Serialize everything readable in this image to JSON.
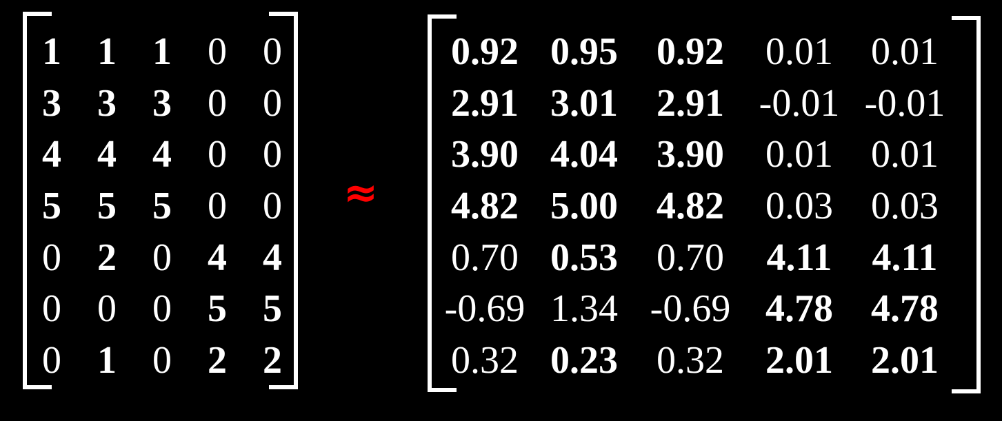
{
  "approx_symbol": "≈",
  "approx_color": "#ff0000",
  "matrix_a": {
    "rows": [
      [
        {
          "v": "1",
          "bold": true
        },
        {
          "v": "1",
          "bold": true
        },
        {
          "v": "1",
          "bold": true
        },
        {
          "v": "0",
          "bold": false
        },
        {
          "v": "0",
          "bold": false
        }
      ],
      [
        {
          "v": "3",
          "bold": true
        },
        {
          "v": "3",
          "bold": true
        },
        {
          "v": "3",
          "bold": true
        },
        {
          "v": "0",
          "bold": false
        },
        {
          "v": "0",
          "bold": false
        }
      ],
      [
        {
          "v": "4",
          "bold": true
        },
        {
          "v": "4",
          "bold": true
        },
        {
          "v": "4",
          "bold": true
        },
        {
          "v": "0",
          "bold": false
        },
        {
          "v": "0",
          "bold": false
        }
      ],
      [
        {
          "v": "5",
          "bold": true
        },
        {
          "v": "5",
          "bold": true
        },
        {
          "v": "5",
          "bold": true
        },
        {
          "v": "0",
          "bold": false
        },
        {
          "v": "0",
          "bold": false
        }
      ],
      [
        {
          "v": "0",
          "bold": false
        },
        {
          "v": "2",
          "bold": true
        },
        {
          "v": "0",
          "bold": false
        },
        {
          "v": "4",
          "bold": true
        },
        {
          "v": "4",
          "bold": true
        }
      ],
      [
        {
          "v": "0",
          "bold": false
        },
        {
          "v": "0",
          "bold": false
        },
        {
          "v": "0",
          "bold": false
        },
        {
          "v": "5",
          "bold": true
        },
        {
          "v": "5",
          "bold": true
        }
      ],
      [
        {
          "v": "0",
          "bold": false
        },
        {
          "v": "1",
          "bold": true
        },
        {
          "v": "0",
          "bold": false
        },
        {
          "v": "2",
          "bold": true
        },
        {
          "v": "2",
          "bold": true
        }
      ]
    ]
  },
  "matrix_b": {
    "rows": [
      [
        {
          "v": "0.92",
          "bold": true
        },
        {
          "v": "0.95",
          "bold": true
        },
        {
          "v": "0.92",
          "bold": true
        },
        {
          "v": "0.01",
          "bold": false
        },
        {
          "v": "0.01",
          "bold": false
        }
      ],
      [
        {
          "v": "2.91",
          "bold": true
        },
        {
          "v": "3.01",
          "bold": true
        },
        {
          "v": "2.91",
          "bold": true
        },
        {
          "v": "-0.01",
          "bold": false
        },
        {
          "v": "-0.01",
          "bold": false
        }
      ],
      [
        {
          "v": "3.90",
          "bold": true
        },
        {
          "v": "4.04",
          "bold": true
        },
        {
          "v": "3.90",
          "bold": true
        },
        {
          "v": "0.01",
          "bold": false
        },
        {
          "v": "0.01",
          "bold": false
        }
      ],
      [
        {
          "v": "4.82",
          "bold": true
        },
        {
          "v": "5.00",
          "bold": true
        },
        {
          "v": "4.82",
          "bold": true
        },
        {
          "v": "0.03",
          "bold": false
        },
        {
          "v": "0.03",
          "bold": false
        }
      ],
      [
        {
          "v": "0.70",
          "bold": false
        },
        {
          "v": "0.53",
          "bold": true
        },
        {
          "v": "0.70",
          "bold": false
        },
        {
          "v": "4.11",
          "bold": true
        },
        {
          "v": "4.11",
          "bold": true
        }
      ],
      [
        {
          "v": "-0.69",
          "bold": false
        },
        {
          "v": "1.34",
          "bold": false
        },
        {
          "v": "-0.69",
          "bold": false
        },
        {
          "v": "4.78",
          "bold": true
        },
        {
          "v": "4.78",
          "bold": true
        }
      ],
      [
        {
          "v": "0.32",
          "bold": false
        },
        {
          "v": "0.23",
          "bold": true
        },
        {
          "v": "0.32",
          "bold": false
        },
        {
          "v": "2.01",
          "bold": true
        },
        {
          "v": "2.01",
          "bold": true
        }
      ]
    ]
  }
}
